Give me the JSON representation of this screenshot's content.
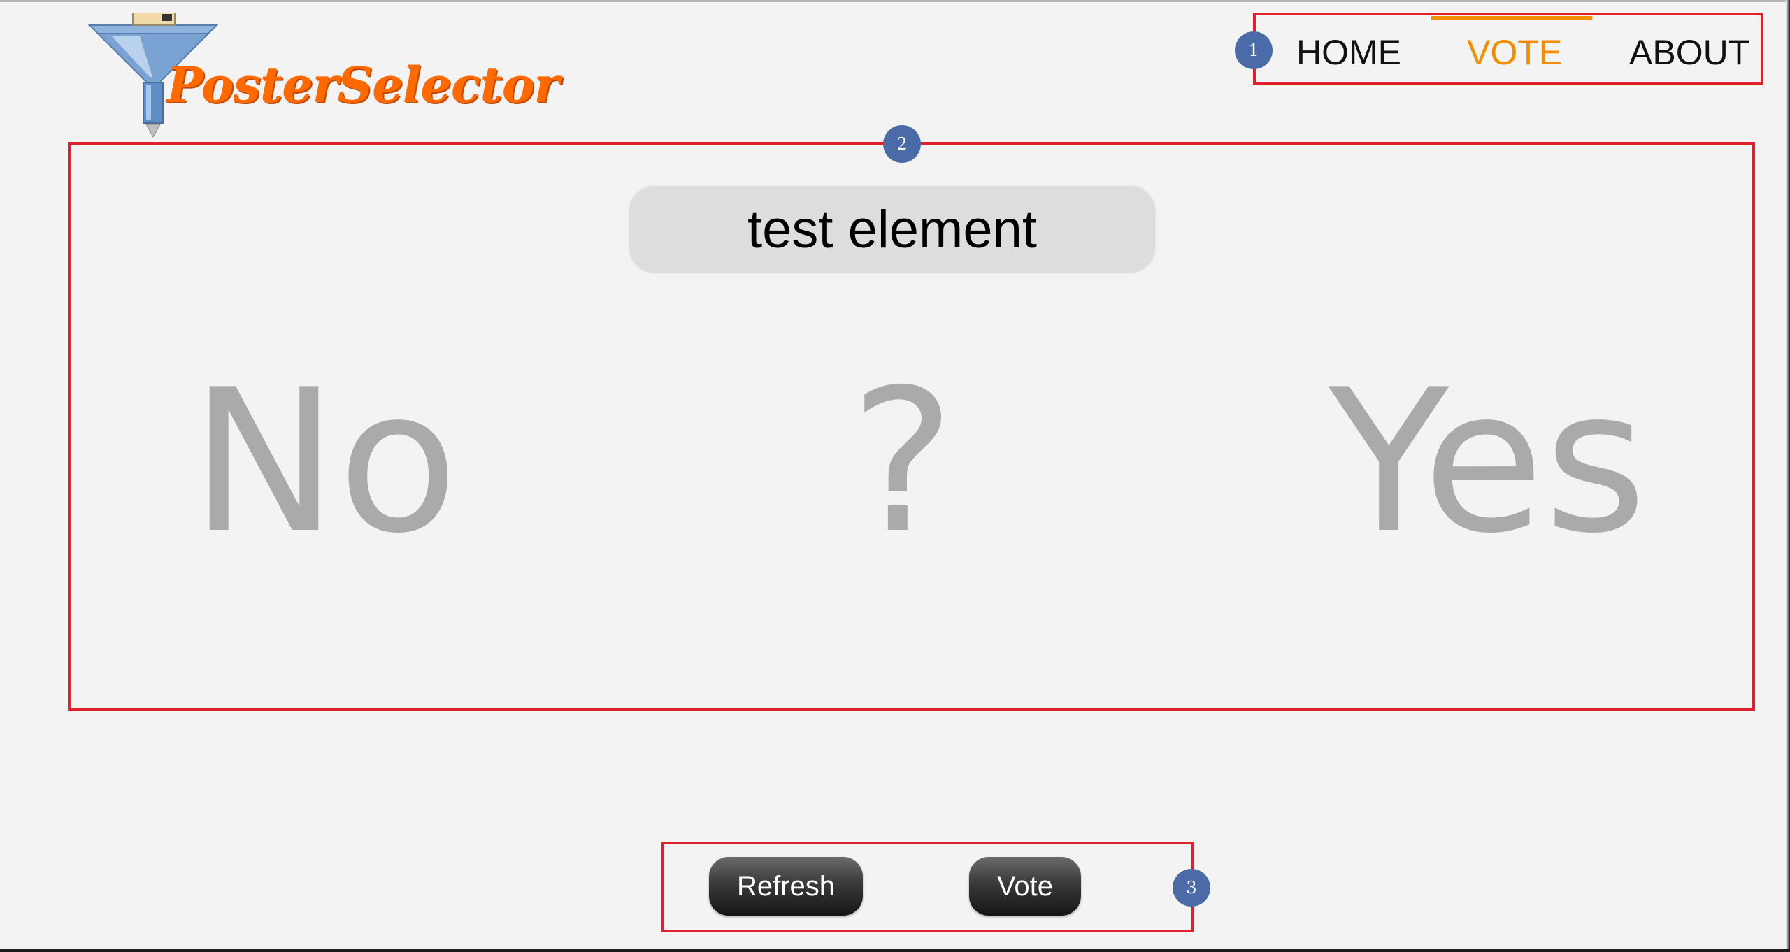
{
  "brand": {
    "logo_text": "PosterSelector",
    "icon": "funnel-icon"
  },
  "nav": {
    "items": [
      {
        "label": "HOME"
      },
      {
        "label": "VOTE",
        "active": true
      },
      {
        "label": "ABOUT"
      }
    ]
  },
  "element": {
    "title": "test element"
  },
  "choices": {
    "no": "No",
    "unsure": "?",
    "yes": "Yes"
  },
  "actions": {
    "refresh_label": "Refresh",
    "vote_label": "Vote"
  },
  "annotations": {
    "badges": [
      "1",
      "2",
      "3"
    ]
  },
  "colors": {
    "accent": "#f28c00",
    "logo": "#ff6a00",
    "annotation_border": "#e0202b",
    "annotation_badge": "#4a6ba8",
    "choice_text": "#aaaaaa"
  }
}
